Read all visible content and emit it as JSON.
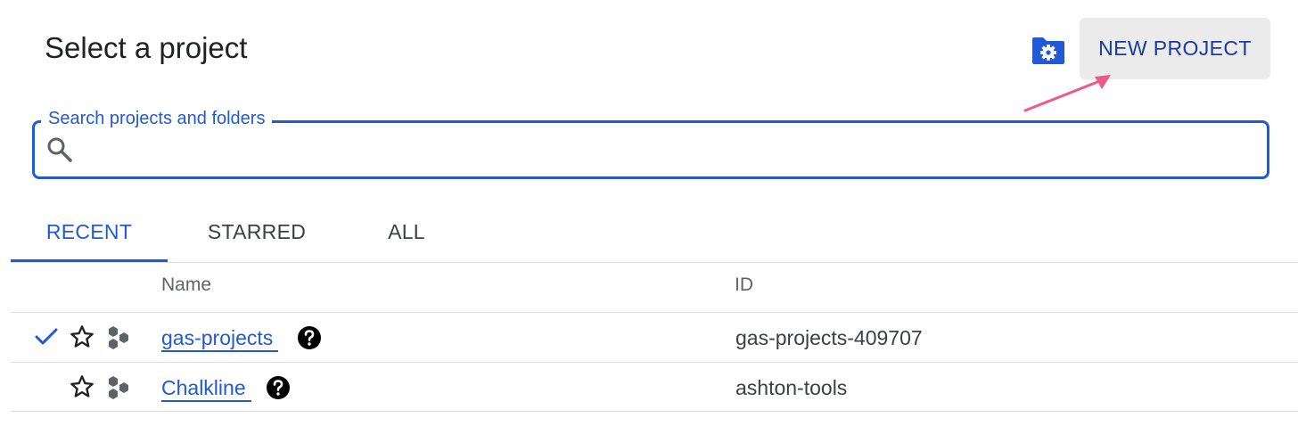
{
  "dialog": {
    "title": "Select a project",
    "new_project_label": "NEW PROJECT"
  },
  "search": {
    "label": "Search projects and folders",
    "value": ""
  },
  "tabs": [
    {
      "label": "RECENT",
      "active": true
    },
    {
      "label": "STARRED",
      "active": false
    },
    {
      "label": "ALL",
      "active": false
    }
  ],
  "table": {
    "columns": [
      "Name",
      "ID"
    ],
    "rows": [
      {
        "name": "gas-projects",
        "id": "gas-projects-409707",
        "selected": true,
        "starred": false
      },
      {
        "name": "Chalkline",
        "id": "ashton-tools",
        "selected": false,
        "starred": false
      }
    ]
  },
  "icons": {
    "folder": "folder-settings-icon",
    "search": "search-icon",
    "check": "check-icon",
    "star": "star-outline-icon",
    "project": "project-hexagons-icon",
    "help": "help-circle-icon"
  },
  "colors": {
    "accent": "#2259d6",
    "button_bg": "#ebebeb",
    "button_text": "#1a3a9e",
    "annotation_arrow": "#f0588a"
  }
}
